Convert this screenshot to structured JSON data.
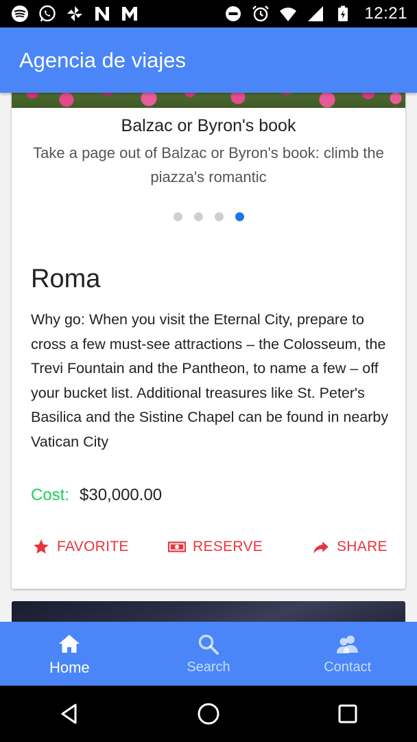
{
  "status_bar": {
    "time": "12:21",
    "left_icons": [
      "spotify-icon",
      "whatsapp-icon",
      "pinwheel-icon",
      "n-app-icon",
      "m-app-icon"
    ],
    "right_icons": [
      "do-not-disturb-icon",
      "alarm-icon",
      "wifi-icon",
      "signal-icon",
      "battery-icon"
    ]
  },
  "app_bar": {
    "title": "Agencia de viajes"
  },
  "card": {
    "slide": {
      "title": "Balzac or Byron's book",
      "text": "Take a page out of Balzac or Byron's book: climb the piazza's romantic",
      "dot_count": 4,
      "active_index": 3
    },
    "place_title": "Roma",
    "description": "Why go: When you visit the Eternal City, prepare to cross a few must-see attractions – the Colosseum, the Trevi Fountain and the Pantheon, to name a few – off your bucket list. Additional treasures like St. Peter's Basilica and the Sistine Chapel can be found in nearby Vatican City",
    "cost_label": "Cost:",
    "cost_value": "$30,000.00",
    "actions": {
      "favorite": "FAVORITE",
      "reserve": "RESERVE",
      "share": "SHARE"
    }
  },
  "bottom_nav": {
    "items": [
      {
        "label": "Home",
        "icon": "home-icon",
        "active": true
      },
      {
        "label": "Search",
        "icon": "search-icon",
        "active": false
      },
      {
        "label": "Contact",
        "icon": "contact-icon",
        "active": false
      }
    ]
  },
  "colors": {
    "primary": "#4a86f7",
    "accent": "#e8353c",
    "cost_label": "#1ed05a",
    "dot_active": "#1f74ef"
  }
}
